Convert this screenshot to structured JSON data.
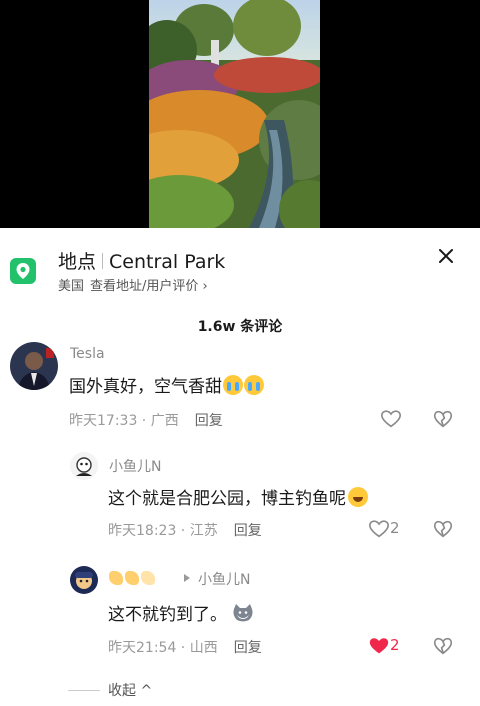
{
  "location": {
    "label": "地点",
    "name": "Central Park",
    "country": "美国",
    "detail_link": "查看地址/用户评价 ›"
  },
  "comments_header": {
    "count_label": "1.6w 条评论"
  },
  "comments": [
    {
      "user": "Tesla",
      "text": "国外真好，空气香甜",
      "time": "昨天17:33",
      "region": "广西",
      "reply_label": "回复",
      "likes": ""
    },
    {
      "user": "小鱼儿N",
      "text": "这个就是合肥公园，博主钓鱼呢",
      "time": "昨天18:23",
      "region": "江苏",
      "reply_label": "回复",
      "likes": "2"
    },
    {
      "user": "小鱼儿N",
      "text": "这不就钓到了。",
      "time": "昨天21:54",
      "region": "山西",
      "reply_label": "回复",
      "likes": "2"
    }
  ],
  "collapse_label": "收起 ^",
  "icons": {
    "location": "map-pin-icon",
    "close": "close-icon",
    "like": "heart-icon",
    "dislike": "thumbs-down-icon",
    "reply_to": "reply-arrow-icon"
  },
  "colors": {
    "location_badge": "#23c16b",
    "liked_heart": "#f0294c"
  }
}
